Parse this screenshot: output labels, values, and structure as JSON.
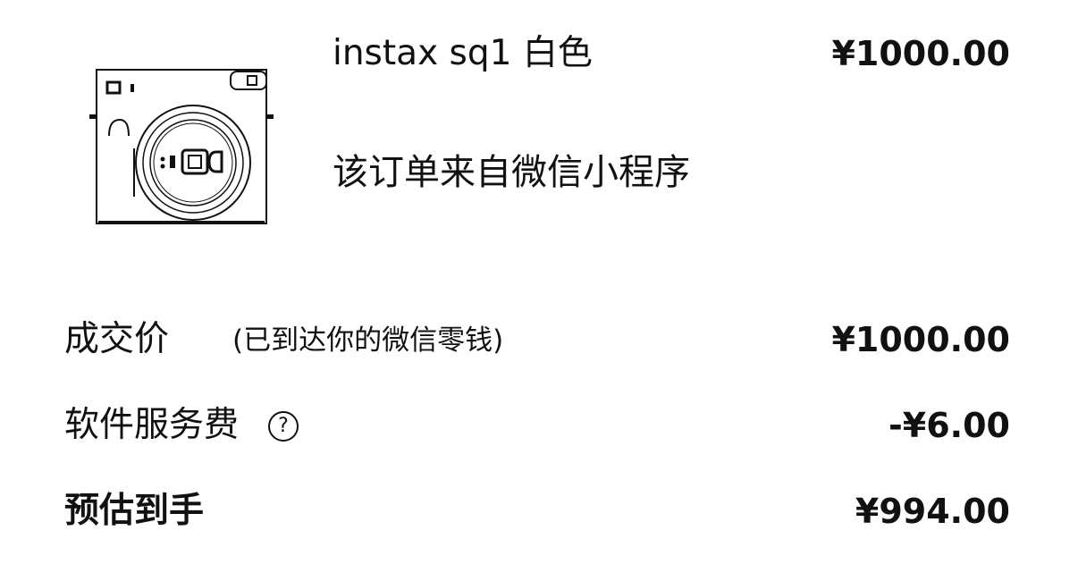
{
  "product": {
    "name": "instax sq1 白色",
    "price": "¥1000.00",
    "source": "该订单来自微信小程序",
    "image_icon": "instant-camera-icon"
  },
  "summary": {
    "deal": {
      "label": "成交价",
      "note": "(已到达你的微信零钱)",
      "amount": "¥1000.00"
    },
    "fee": {
      "label": "软件服务费",
      "help_icon": "question-circle-icon",
      "help_glyph": "?",
      "amount": "-¥6.00"
    },
    "net": {
      "label": "预估到手",
      "amount": "¥994.00"
    }
  }
}
